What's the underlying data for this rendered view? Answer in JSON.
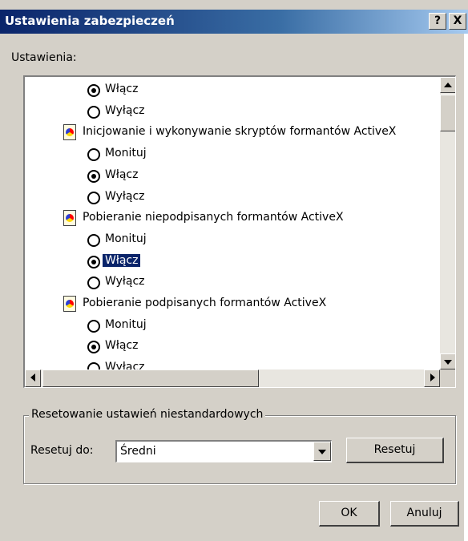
{
  "window": {
    "title": "Ustawienia zabezpieczeń",
    "help_button": "?",
    "close_button": "X"
  },
  "settings_label": "Ustawienia:",
  "list": {
    "rows": [
      {
        "type": "radio",
        "text": "Włącz",
        "checked": true
      },
      {
        "type": "radio",
        "text": "Wyłącz",
        "checked": false
      },
      {
        "type": "header",
        "text": "Inicjowanie i wykonywanie skryptów formantów ActiveX",
        "icon": "security-setting-icon"
      },
      {
        "type": "radio",
        "text": "Monituj",
        "checked": false
      },
      {
        "type": "radio",
        "text": "Włącz",
        "checked": true
      },
      {
        "type": "radio",
        "text": "Wyłącz",
        "checked": false
      },
      {
        "type": "header",
        "text": "Pobieranie niepodpisanych formantów ActiveX",
        "icon": "security-setting-icon"
      },
      {
        "type": "radio",
        "text": "Monituj",
        "checked": false
      },
      {
        "type": "radio",
        "text": "Włącz",
        "checked": true,
        "selected": true
      },
      {
        "type": "radio",
        "text": "Wyłącz",
        "checked": false
      },
      {
        "type": "header",
        "text": "Pobieranie podpisanych formantów ActiveX",
        "icon": "security-setting-icon"
      },
      {
        "type": "radio",
        "text": "Monituj",
        "checked": false
      },
      {
        "type": "radio",
        "text": "Włącz",
        "checked": true
      },
      {
        "type": "radio",
        "text": "Wyłącz",
        "checked": false
      }
    ]
  },
  "reset_group": {
    "legend": "Resetowanie ustawień niestandardowych",
    "label": "Resetuj do:",
    "selected_value": "Średni",
    "reset_button": "Resetuj"
  },
  "footer": {
    "ok_button": "OK",
    "cancel_button": "Anuluj"
  },
  "colors": {
    "title_bar": "#0a246a",
    "selection": "#0a246a",
    "window_face": "#d4d0c8"
  }
}
